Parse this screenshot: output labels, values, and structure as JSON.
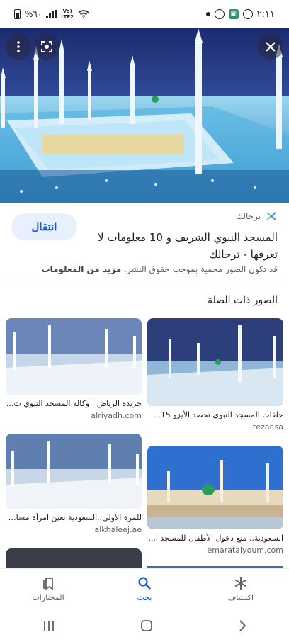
{
  "status_bar": {
    "time": "٢:١١",
    "battery_percent": "%٦٠",
    "network": "LTE2",
    "volte": "Vo)"
  },
  "hero": {
    "more_icon": "more-vert-icon",
    "lens_icon": "lens-icon",
    "close_icon": "close-icon"
  },
  "source": {
    "name": "ترحالك",
    "visit_label": "انتقال",
    "title": "المسجد النبوي الشريف و 10 معلومات لا تعرفها - ترحالك",
    "copyright_text": "قد تكون الصور محمية بموجب حقوق النشر.",
    "learn_more": "مزيد من المعلومات"
  },
  "related": {
    "heading": "الصور ذات الصلة",
    "items": [
      {
        "caption": "حلقات المسجد النبوي تحصد الأيزو 15...",
        "domain": "tezar.sa"
      },
      {
        "caption": "جريدة الرياض | وكالة المسجد النبوي ت...",
        "domain": "alriyadh.com"
      },
      {
        "caption": "السعودية.. منع دخول الأطفال للمسجد ا...",
        "domain": "emaratalyoum.com"
      },
      {
        "caption": "للمرة الأولى..السعودية تعين امرأة مساع...",
        "domain": "alkhaleej.ae"
      }
    ]
  },
  "bottom_nav": {
    "discover": "اكتشاف",
    "search": "بحث",
    "saved": "المختارات"
  },
  "colors": {
    "accent": "#1a56c7",
    "visit_bg": "#e8f0fe"
  }
}
